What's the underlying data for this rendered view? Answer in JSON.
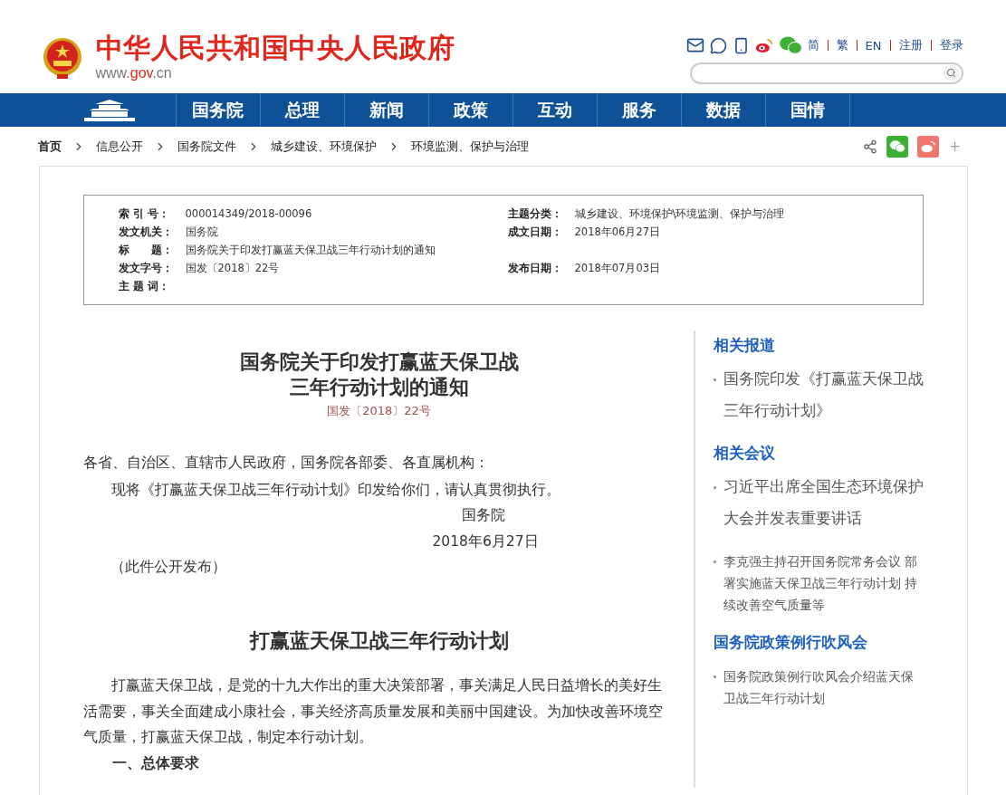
{
  "header": {
    "site_title": "中华人民共和国中央人民政府",
    "site_url_prefix": "www.",
    "site_url_domain": "gov",
    "site_url_suffix": ".cn",
    "languages": [
      "简",
      "繁",
      "EN"
    ],
    "account_links": [
      "注册",
      "登录"
    ]
  },
  "nav": {
    "items": [
      "国务院",
      "总理",
      "新闻",
      "政策",
      "互动",
      "服务",
      "数据",
      "国情"
    ]
  },
  "breadcrumb": [
    "首页",
    "信息公开",
    "国务院文件",
    "城乡建设、环境保护",
    "环境监测、保护与治理"
  ],
  "meta": {
    "rows": [
      {
        "left": {
          "label": "索 引 号：",
          "value": "000014349/2018-00096"
        },
        "right": {
          "label": "主题分类：",
          "value": "城乡建设、环境保护\\环境监测、保护与治理"
        }
      },
      {
        "left": {
          "label": "发文机关：",
          "value": "国务院"
        },
        "right": {
          "label": "成文日期：",
          "value": "2018年06月27日"
        }
      },
      {
        "left": {
          "label": "标　　题：",
          "value": "国务院关于印发打赢蓝天保卫战三年行动计划的通知"
        }
      },
      {
        "left": {
          "label": "发文字号：",
          "value": "国发〔2018〕22号"
        },
        "right": {
          "label": "发布日期：",
          "value": "2018年07月03日"
        }
      },
      {
        "left": {
          "label": "主 题 词："
        }
      }
    ]
  },
  "article": {
    "title_lines": [
      "国务院关于印发打赢蓝天保卫战",
      "三年行动计划的通知"
    ],
    "doc_number": "国发〔2018〕22号",
    "paragraphs": [
      {
        "kind": "plain",
        "text": "各省、自治区、直辖市人民政府，国务院各部委、各直属机构："
      },
      {
        "kind": "indent",
        "text": "现将《打赢蓝天保卫战三年行动计划》印发给你们，请认真贯彻执行。"
      },
      {
        "kind": "signer",
        "text": "国务院"
      },
      {
        "kind": "date",
        "text": "2018年6月27日"
      },
      {
        "kind": "note",
        "text": "（此件公开发布）"
      },
      {
        "kind": "heading",
        "text": "打赢蓝天保卫战三年行动计划"
      },
      {
        "kind": "indent",
        "text": "打赢蓝天保卫战，是党的十九大作出的重大决策部署，事关满足人民日益增长的美好生活需要，事关全面建成小康社会，事关经济高质量发展和美丽中国建设。为加快改善环境空气质量，打赢蓝天保卫战，制定本行动计划。"
      },
      {
        "kind": "section",
        "text": "一、总体要求"
      }
    ]
  },
  "sidebar": {
    "sections": [
      {
        "title": "相关报道",
        "items": [
          {
            "kind": "large",
            "text": "国务院印发《打赢蓝天保卫战三年行动计划》"
          }
        ]
      },
      {
        "title": "相关会议",
        "items": [
          {
            "kind": "large",
            "text": "习近平出席全国生态环境保护大会并发表重要讲话"
          },
          {
            "kind": "small",
            "text": "李克强主持召开国务院常务会议 部署实施蓝天保卫战三年行动计划 持续改善空气质量等"
          }
        ]
      },
      {
        "title": "国务院政策例行吹风会",
        "items": [
          {
            "kind": "small",
            "text": "国务院政策例行吹风会介绍蓝天保卫战三年行动计划"
          }
        ]
      }
    ]
  }
}
